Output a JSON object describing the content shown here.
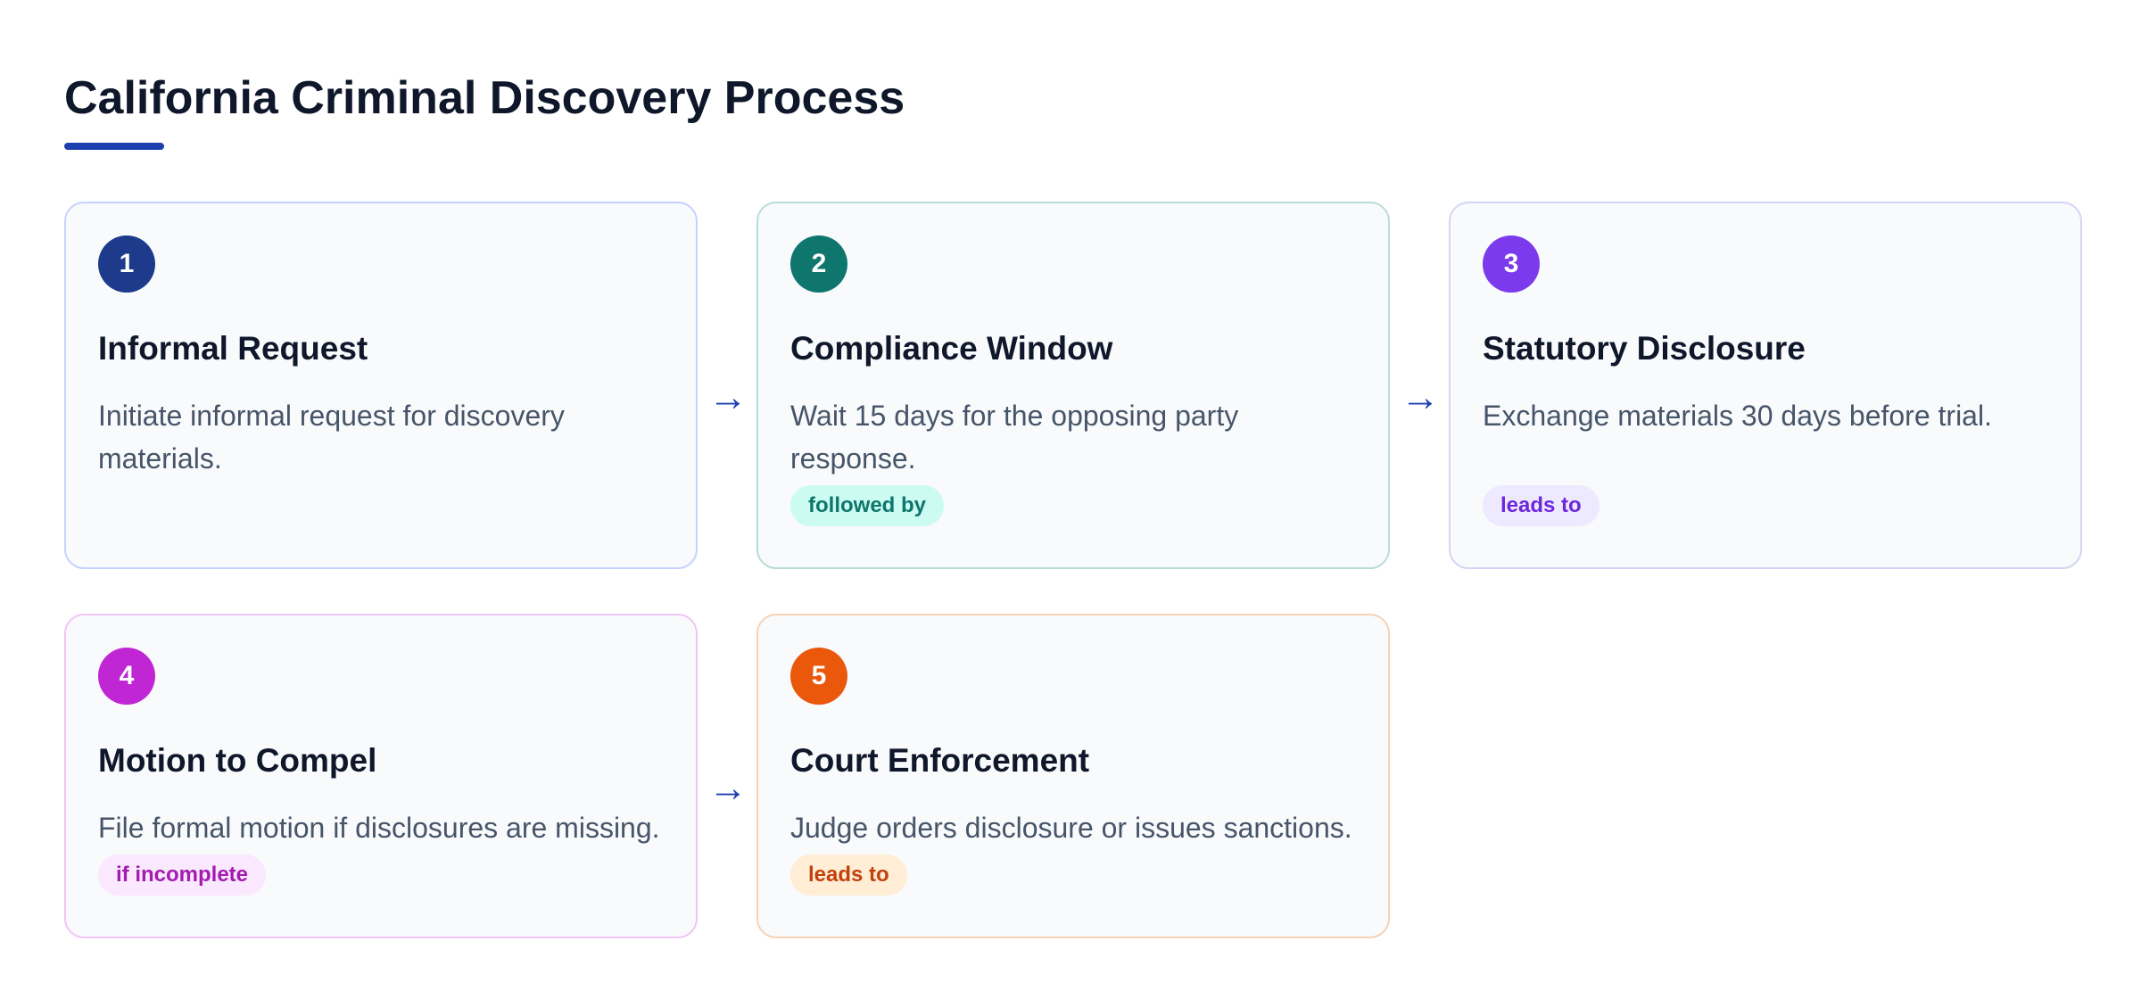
{
  "title": "California Criminal Discovery Process",
  "colors": {
    "accent": "#1e40af"
  },
  "steps": [
    {
      "number": "1",
      "title": "Informal Request",
      "description": "Initiate informal request for discovery materials.",
      "color": "#1e3a8a",
      "border": "#c7d2fe"
    },
    {
      "number": "2",
      "title": "Compliance Window",
      "description": "Wait 15 days for the opposing party response.",
      "tag": "followed by",
      "color": "#0f766e",
      "border": "#b9dcd8",
      "tag_bg": "#ccfbf1",
      "tag_color": "#0f766e"
    },
    {
      "number": "3",
      "title": "Statutory Disclosure",
      "description": "Exchange materials 30 days before trial.",
      "tag": "leads to",
      "color": "#7c3aed",
      "border": "#d4d4f5",
      "tag_bg": "#ede9fe",
      "tag_color": "#6d28d9"
    },
    {
      "number": "4",
      "title": "Motion to Compel",
      "description": "File formal motion if disclosures are missing.",
      "tag": "if incomplete",
      "color": "#c026d3",
      "border": "#f0c5f5",
      "tag_bg": "#fae8ff",
      "tag_color": "#a21caf"
    },
    {
      "number": "5",
      "title": "Court Enforcement",
      "description": "Judge orders disclosure or issues sanctions.",
      "tag": "leads to",
      "color": "#ea580c",
      "border": "#f9d0b4",
      "tag_bg": "#ffedd5",
      "tag_color": "#c2410c"
    }
  ],
  "arrows": [
    {
      "symbol": "→"
    },
    {
      "symbol": "→"
    },
    {
      "symbol": "→"
    }
  ]
}
